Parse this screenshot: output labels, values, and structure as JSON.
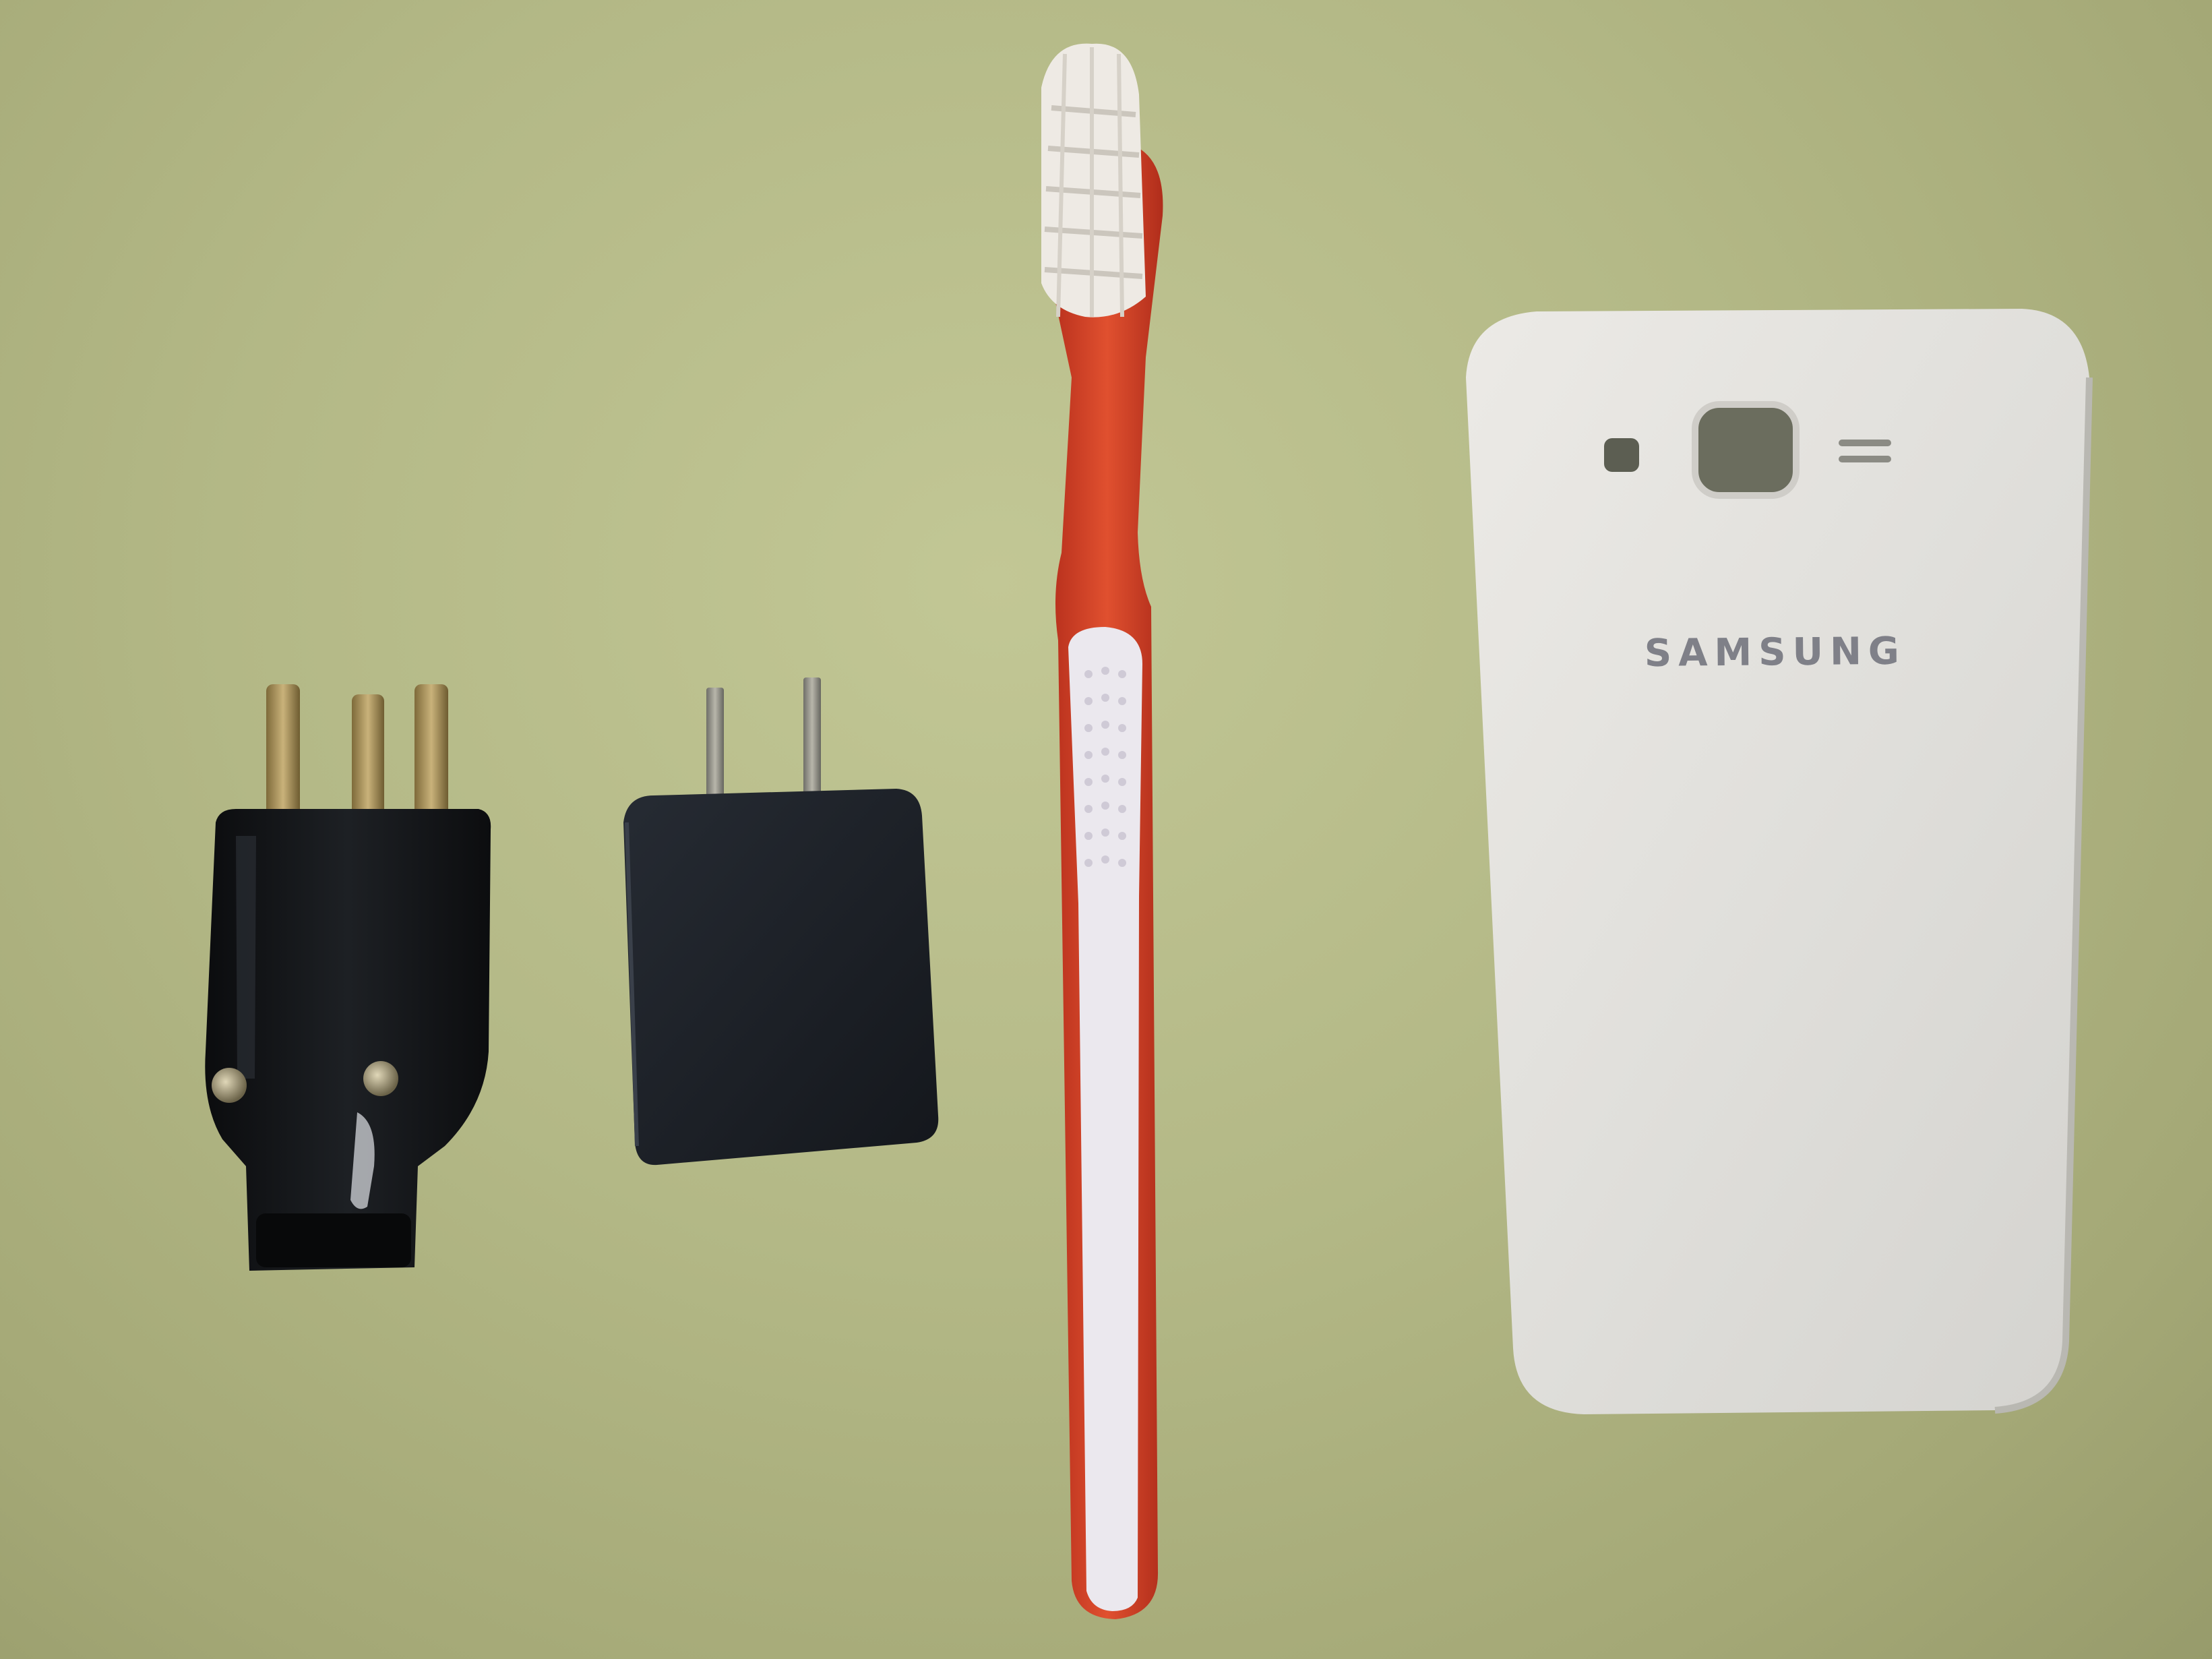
{
  "image": {
    "objects": [
      {
        "name": "three-pin-plug",
        "color": "#15171a"
      },
      {
        "name": "usb-charger",
        "color": "#1c2026"
      },
      {
        "name": "toothbrush",
        "color": "#d9432a"
      },
      {
        "name": "phone-back-cover",
        "color": "#e4e3df"
      }
    ],
    "background_color": "#b4b98a"
  },
  "phone_cover": {
    "brand_text": "SAMSUNG"
  }
}
